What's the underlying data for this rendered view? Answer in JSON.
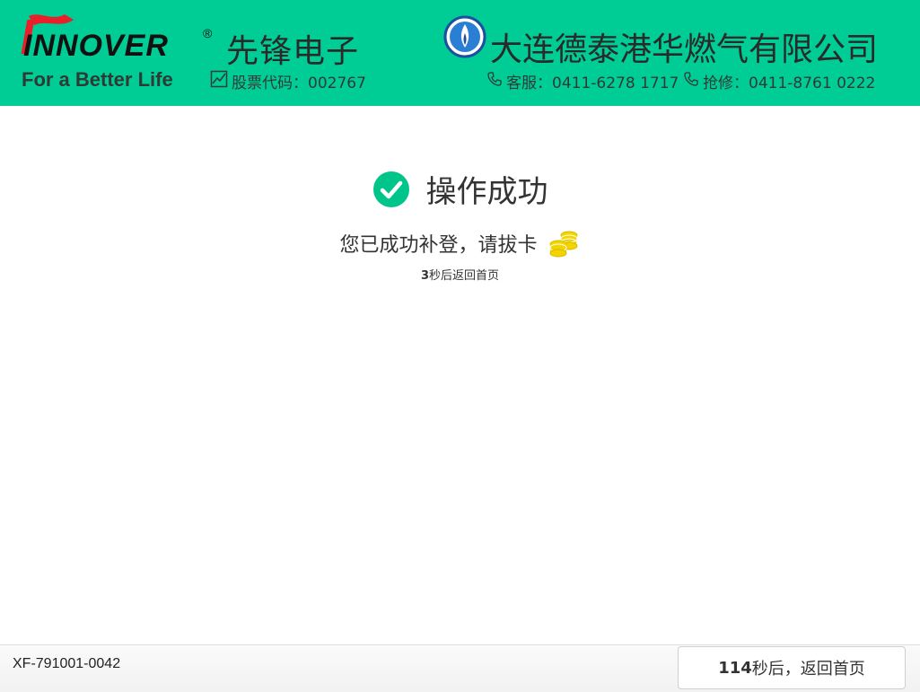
{
  "header": {
    "brand_logo_text": "INNOVER",
    "brand_name": "先锋电子",
    "slogan": "For a Better Life",
    "stock_label": "股票代码：002767",
    "gas_company": "大连德泰港华燃气有限公司",
    "service_hotline": "客服：0411-6278 1717",
    "repair_hotline": "抢修：0411-8761 0222",
    "brand_color": "#00cd96"
  },
  "result": {
    "title": "操作成功",
    "message": "您已成功补登，请拔卡",
    "countdown_seconds": "3",
    "countdown_suffix": "秒后返回首页",
    "success_color": "#00c58a"
  },
  "footer": {
    "device_id": "XF-791001-0042",
    "button_seconds": "114",
    "button_suffix": "秒后，返回首页"
  },
  "icons": {
    "check": "check-circle-icon",
    "coins": "coins-icon",
    "phone": "phone-icon",
    "chart": "chart-icon"
  }
}
